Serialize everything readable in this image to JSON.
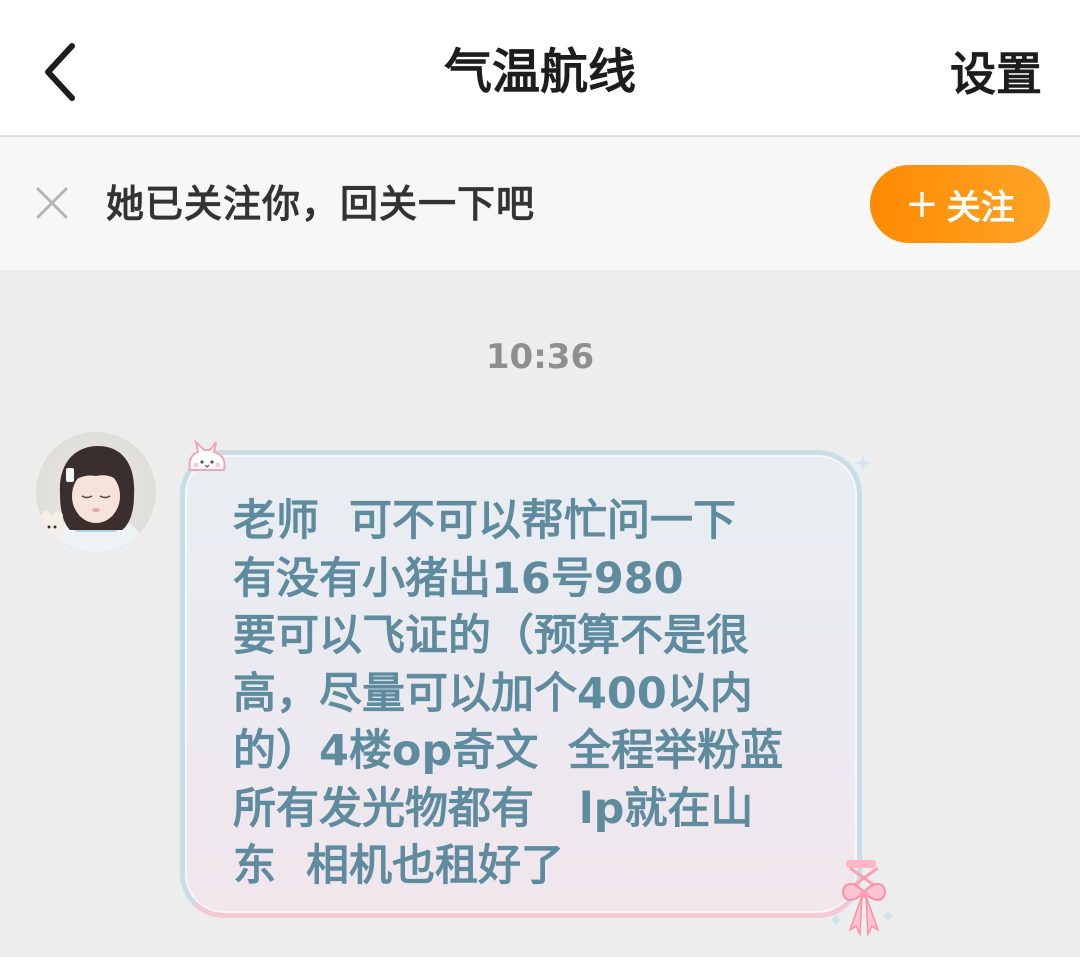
{
  "header": {
    "title": "气温航线",
    "settings_label": "设置"
  },
  "follow_bar": {
    "message": "她已关注你，回关一下吧",
    "button_label": "关注",
    "button_plus": "+"
  },
  "chat": {
    "timestamp": "10:36",
    "messages": [
      {
        "sender": "other",
        "text": "老师  可不可以帮忙问一下\n有没有小猪出16号980\n要可以飞证的（预算不是很\n高，尽量可以加个400以内\n的）4楼op奇文  全程举粉蓝\n所有发光物都有   lp就在山\n东  相机也租好了"
      }
    ]
  },
  "colors": {
    "accent_orange": "#ff8a00",
    "bubble_text": "#5e8b9e",
    "timestamp": "#8f8f8f",
    "background": "#ededed"
  }
}
